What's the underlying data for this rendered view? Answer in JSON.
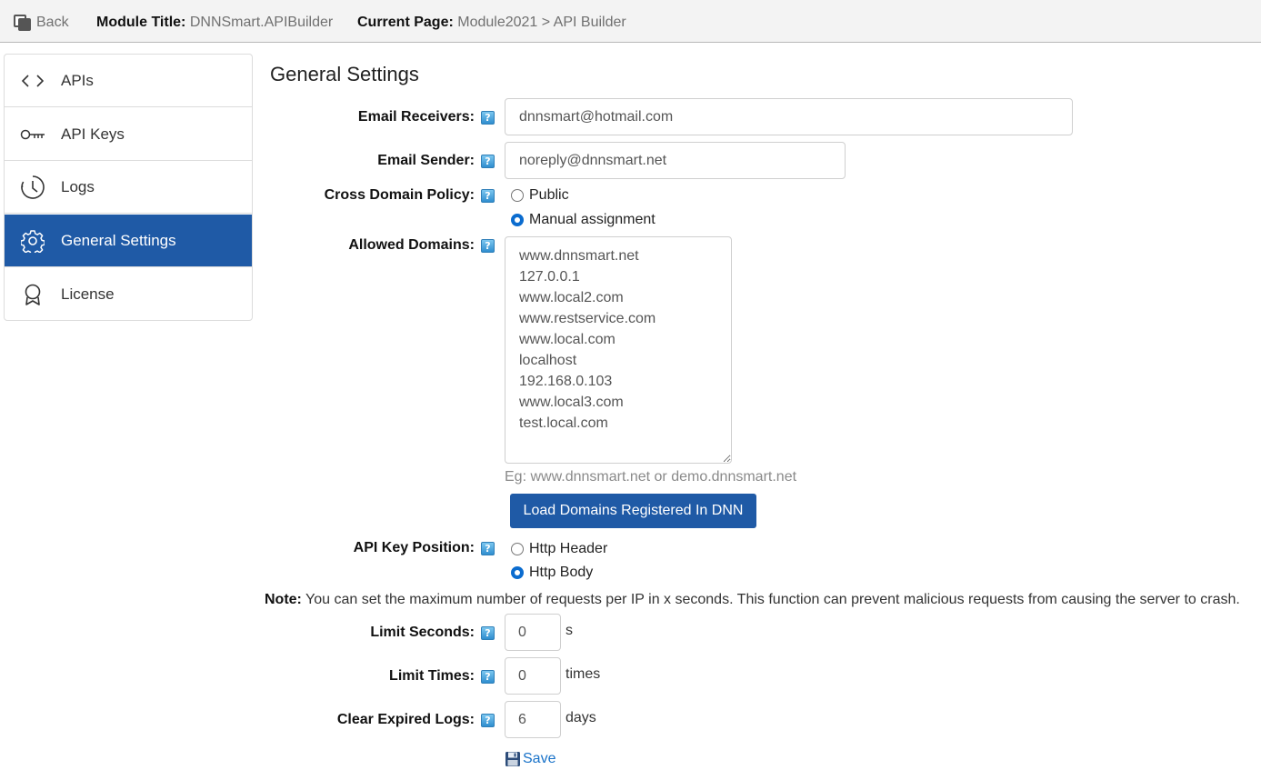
{
  "topbar": {
    "back_label": "Back",
    "module_title_label": "Module Title:",
    "module_title_value": "DNNSmart.APIBuilder",
    "current_page_label": "Current Page:",
    "current_page_value": "Module2021 > API Builder"
  },
  "sidebar": {
    "items": [
      {
        "label": "APIs",
        "icon": "code-icon",
        "active": false
      },
      {
        "label": "API Keys",
        "icon": "key-icon",
        "active": false
      },
      {
        "label": "Logs",
        "icon": "clock-icon",
        "active": false
      },
      {
        "label": "General Settings",
        "icon": "gear-icon",
        "active": true
      },
      {
        "label": "License",
        "icon": "award-icon",
        "active": false
      }
    ]
  },
  "main": {
    "title": "General Settings",
    "email_receivers": {
      "label": "Email Receivers:",
      "value": "dnnsmart@hotmail.com"
    },
    "email_sender": {
      "label": "Email Sender:",
      "value": "noreply@dnnsmart.net"
    },
    "cross_domain": {
      "label": "Cross Domain Policy:",
      "options": [
        "Public",
        "Manual assignment"
      ],
      "selected": "Manual assignment"
    },
    "allowed_domains": {
      "label": "Allowed Domains:",
      "value": "www.dnnsmart.net\n127.0.0.1\nwww.local2.com\nwww.restservice.com\nwww.local.com\nlocalhost\n192.168.0.103\nwww.local3.com\ntest.local.com",
      "hint": "Eg: www.dnnsmart.net or demo.dnnsmart.net"
    },
    "load_domains_button": "Load Domains Registered In DNN",
    "api_key_position": {
      "label": "API Key Position:",
      "options": [
        "Http Header",
        "Http Body"
      ],
      "selected": "Http Body"
    },
    "note_label": "Note:",
    "note_text": " You can set the maximum number of requests per IP in x seconds. This function can prevent malicious requests from causing the server to crash.",
    "limit_seconds": {
      "label": "Limit Seconds:",
      "value": "0",
      "unit": "s"
    },
    "limit_times": {
      "label": "Limit Times:",
      "value": "0",
      "unit": "times"
    },
    "clear_logs": {
      "label": "Clear Expired Logs:",
      "value": "6",
      "unit": "days"
    },
    "save_label": "Save",
    "help_glyph": "?"
  },
  "colors": {
    "accent": "#1f5aa6",
    "link": "#1a73c9",
    "help": "#2f8ecf"
  }
}
